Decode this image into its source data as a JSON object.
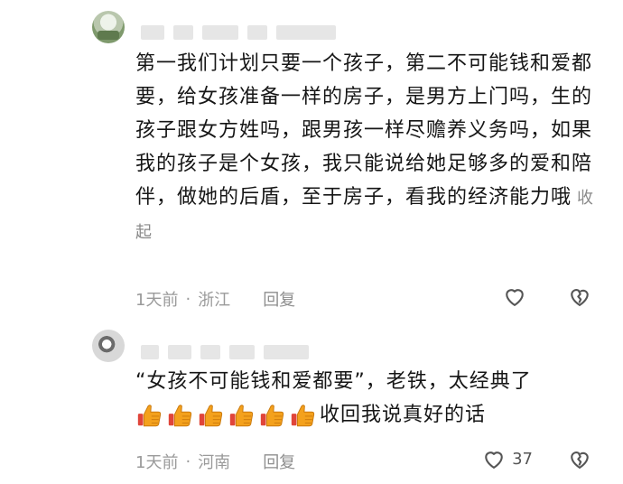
{
  "comments": [
    {
      "text": "第一我们计划只要一个孩子，第二不可能钱和爱都要，给女孩准备一样的房子，是男方上门吗，生的孩子跟女方姓吗，跟男孩一样尽赡养义务吗，如果我的孩子是个女孩，我只能说给她足够多的爱和陪伴，做她的后盾，至于房子，看我的经济能力哦",
      "collapse_label": "收起",
      "time": "1天前",
      "location": "浙江",
      "reply_label": "回复",
      "like_count": ""
    },
    {
      "text": "“女孩不可能钱和爱都要”，老铁，太经典了",
      "emoji_count": 6,
      "emoji_name": "thumbs-up-icon",
      "text_after_emoji": "收回我说真好的话",
      "time": "1天前",
      "location": "河南",
      "reply_label": "回复",
      "like_count": "37"
    }
  ],
  "separator": "·",
  "colors": {
    "meta": "#9a9a9a",
    "text": "#161616",
    "redacted": "#e6e6e6",
    "thumb": "#f4a11c"
  }
}
